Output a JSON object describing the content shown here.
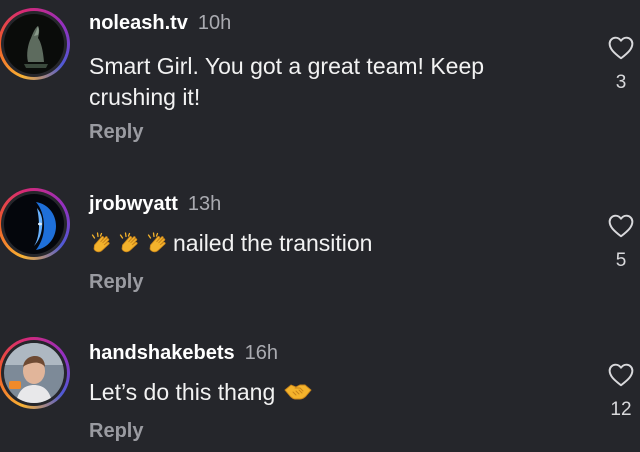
{
  "comments": [
    {
      "username": "noleash.tv",
      "time": "10h",
      "text": "Smart Girl. You got a great team! Keep crushing it!",
      "reply_label": "Reply",
      "likes": "3"
    },
    {
      "username": "jrobwyatt",
      "time": "13h",
      "text_emoji": "clapping-hands-emoji",
      "emoji_count": 3,
      "text": "nailed the transition",
      "reply_label": "Reply",
      "likes": "5"
    },
    {
      "username": "handshakebets",
      "time": "16h",
      "text": "Let’s do this thang",
      "text_emoji": "handshake-emoji",
      "reply_label": "Reply",
      "likes": "12"
    }
  ],
  "colors": {
    "background": "#25262b",
    "username": "#ffffff",
    "timestamp": "#a9aab0",
    "reply": "#9a9ba1",
    "text": "#f2f2f2"
  }
}
